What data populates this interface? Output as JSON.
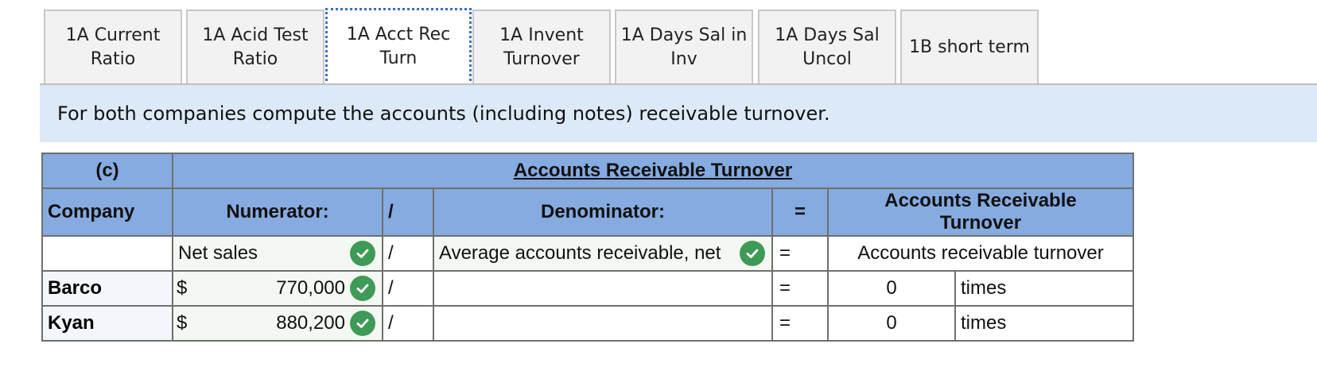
{
  "tabs": [
    {
      "line1": "1A Current",
      "line2": "Ratio"
    },
    {
      "line1": "1A Acid Test",
      "line2": "Ratio"
    },
    {
      "line1": "1A Acct Rec",
      "line2": "Turn"
    },
    {
      "line1": "1A Invent",
      "line2": "Turnover"
    },
    {
      "line1": "1A Days Sal in",
      "line2": "Inv"
    },
    {
      "line1": "1A Days Sal",
      "line2": "Uncol"
    },
    {
      "line1": "1B short term",
      "line2": ""
    }
  ],
  "active_tab": "1A Acct Rec Turn",
  "instruction": "For both companies compute the accounts (including notes) receivable turnover.",
  "table": {
    "part_label": "(c)",
    "title": "Accounts Receivable Turnover",
    "headers": {
      "company": "Company",
      "numerator": "Numerator:",
      "divide": "/",
      "denominator": "Denominator:",
      "equals": "=",
      "result": "Accounts Receivable",
      "result_line2": "Turnover"
    },
    "formula_row": {
      "numerator": "Net sales",
      "divide": "/",
      "denominator": "Average accounts receivable, net",
      "equals": "=",
      "result": "Accounts receivable turnover"
    },
    "rows": [
      {
        "company": "Barco",
        "currency": "$",
        "numerator": "770,000",
        "divide": "/",
        "denominator": "",
        "equals": "=",
        "result": "0",
        "unit": "times"
      },
      {
        "company": "Kyan",
        "currency": "$",
        "numerator": "880,200",
        "divide": "/",
        "denominator": "",
        "equals": "=",
        "result": "0",
        "unit": "times"
      }
    ]
  },
  "colors": {
    "header_blue": "#85abe0",
    "banner_blue": "#dce9f7",
    "check_green": "#3f9a57",
    "active_tab_border": "#3a6fc4"
  },
  "icons": {
    "correct": "check-circle-icon"
  }
}
